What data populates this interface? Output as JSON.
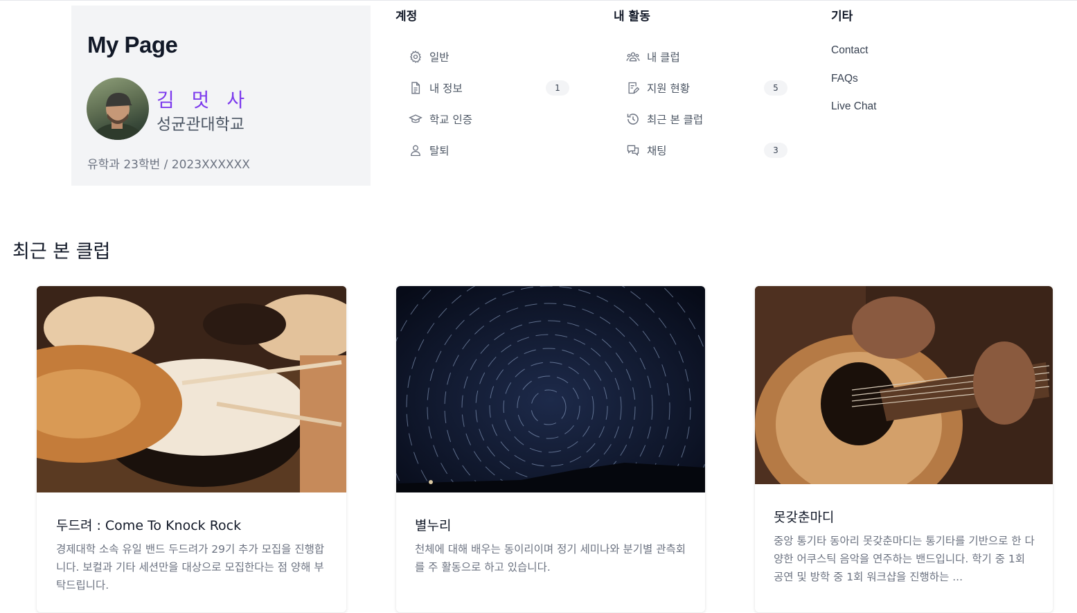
{
  "profile": {
    "title": "My Page",
    "name": "김 멋 사",
    "school": "성균관대학교",
    "meta": "유학과 23학번 / 2023XXXXXX"
  },
  "menu": {
    "account": {
      "heading": "계정",
      "items": [
        {
          "label": "일반",
          "icon": "gear-icon",
          "badge": ""
        },
        {
          "label": "내 정보",
          "icon": "document-icon",
          "badge": "1"
        },
        {
          "label": "학교 인증",
          "icon": "graduation-cap-icon",
          "badge": ""
        },
        {
          "label": "탈퇴",
          "icon": "user-icon",
          "badge": ""
        }
      ]
    },
    "activity": {
      "heading": "내 활동",
      "items": [
        {
          "label": "내 클럽",
          "icon": "users-group-icon",
          "badge": ""
        },
        {
          "label": "지원 현황",
          "icon": "document-edit-icon",
          "badge": "5"
        },
        {
          "label": "최근 본 클럽",
          "icon": "history-icon",
          "badge": ""
        },
        {
          "label": "채팅",
          "icon": "chat-icon",
          "badge": "3"
        }
      ]
    },
    "etc": {
      "heading": "기타",
      "links": [
        "Contact",
        "FAQs",
        "Live Chat"
      ]
    }
  },
  "recent": {
    "title": "최근 본 클럽",
    "cards": [
      {
        "title": "두드려 : Come To Knock Rock",
        "desc": "경제대학 소속 유일 밴드 두드려가 29기 추가 모집을 진행합니다. 보컬과 기타 세션만을 대상으로 모집한다는 점 양해 부탁드립니다.",
        "image": "drum-kit-photo"
      },
      {
        "title": "별누리",
        "desc": "천체에 대해 배우는 동이리이며 정기 세미나와 분기별 관측회를 주 활동으로 하고 있습니다.",
        "image": "star-trails-photo"
      },
      {
        "title": "못갖춘마디",
        "desc": "중앙 통기타 동아리 못갖춘마디는 통기타를 기반으로 한 다양한 어쿠스틱 음악을 연주하는 밴드입니다. 학기 중 1회 공연 및 방학 중 1회 워크샵을 진행하는 ...",
        "image": "acoustic-guitar-photo"
      }
    ]
  },
  "colors": {
    "accent": "#7c3aed",
    "panel": "#f3f4f6"
  }
}
